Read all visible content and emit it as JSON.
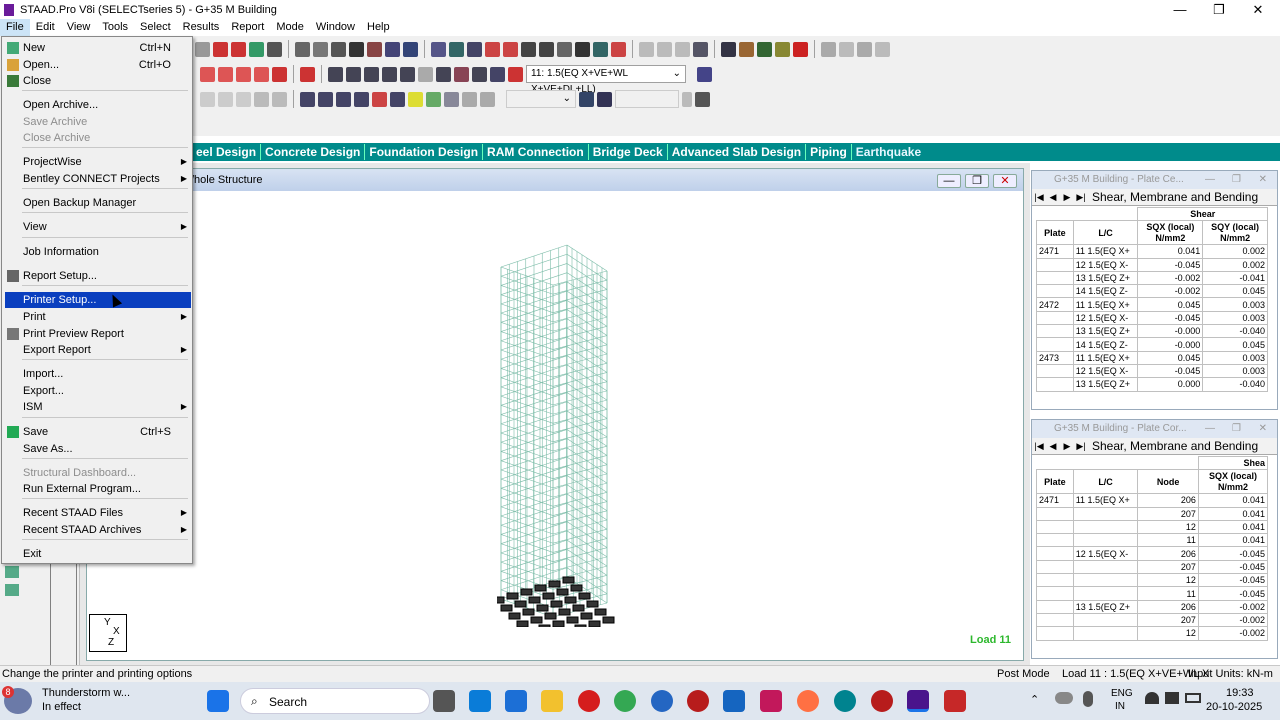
{
  "window": {
    "title": "STAAD.Pro V8i (SELECTseries 5) - G+35 M Building",
    "controls": [
      "—",
      "❐",
      "✕"
    ]
  },
  "menubar": [
    "File",
    "Edit",
    "View",
    "Tools",
    "Select",
    "Results",
    "Report",
    "Mode",
    "Window",
    "Help"
  ],
  "toolbar": {
    "load_case_combo": "11: 1.5(EQ X+VE+WL X+VE+DL+LL)"
  },
  "ribbon_tabs": [
    "eel Design",
    "Concrete Design",
    "Foundation Design",
    "RAM Connection",
    "Bridge Deck",
    "Advanced Slab Design",
    "Piping",
    "Earthquake"
  ],
  "viewport": {
    "title": "/hole Structure",
    "load_label": "Load 11",
    "axis": {
      "y": "Y",
      "x": "X",
      "z": "Z"
    }
  },
  "panel1": {
    "title": "G+35 M Building - Plate Ce...",
    "tab": "Shear, Membrane and Bending",
    "group": "Shear",
    "headers": [
      "Plate",
      "L/C",
      "SQX (local)\nN/mm2",
      "SQY (local)\nN/mm2"
    ],
    "rows": [
      [
        "2471",
        "11 1.5(EQ X+",
        "0.041",
        "0.002"
      ],
      [
        "",
        "12 1.5(EQ X-",
        "-0.045",
        "0.002"
      ],
      [
        "",
        "13 1.5(EQ Z+",
        "-0.002",
        "-0.041"
      ],
      [
        "",
        "14 1.5(EQ Z-",
        "-0.002",
        "0.045"
      ],
      [
        "2472",
        "11 1.5(EQ X+",
        "0.045",
        "0.003"
      ],
      [
        "",
        "12 1.5(EQ X-",
        "-0.045",
        "0.003"
      ],
      [
        "",
        "13 1.5(EQ Z+",
        "-0.000",
        "-0.040"
      ],
      [
        "",
        "14 1.5(EQ Z-",
        "-0.000",
        "0.045"
      ],
      [
        "2473",
        "11 1.5(EQ X+",
        "0.045",
        "0.003"
      ],
      [
        "",
        "12 1.5(EQ X-",
        "-0.045",
        "0.003"
      ],
      [
        "",
        "13 1.5(EQ Z+",
        "0.000",
        "-0.040"
      ]
    ]
  },
  "panel2": {
    "title": "G+35 M Building - Plate Cor...",
    "tab": "Shear, Membrane and Bending",
    "group": "Shea",
    "headers": [
      "Plate",
      "L/C",
      "Node",
      "SQX (local)\nN/mm2"
    ],
    "rows": [
      [
        "2471",
        "11 1.5(EQ X+",
        "206",
        "0.041"
      ],
      [
        "",
        "",
        "207",
        "0.041"
      ],
      [
        "",
        "",
        "12",
        "0.041"
      ],
      [
        "",
        "",
        "11",
        "0.041"
      ],
      [
        "",
        "12 1.5(EQ X-",
        "206",
        "-0.045"
      ],
      [
        "",
        "",
        "207",
        "-0.045"
      ],
      [
        "",
        "",
        "12",
        "-0.045"
      ],
      [
        "",
        "",
        "11",
        "-0.045"
      ],
      [
        "",
        "13 1.5(EQ Z+",
        "206",
        "-0.002"
      ],
      [
        "",
        "",
        "207",
        "-0.002"
      ],
      [
        "",
        "",
        "12",
        "-0.002"
      ]
    ]
  },
  "file_menu": [
    {
      "label": "New",
      "shortcut": "Ctrl+N"
    },
    {
      "label": "Open...",
      "shortcut": "Ctrl+O"
    },
    {
      "label": "Close"
    },
    {
      "label": "Open Archive..."
    },
    {
      "label": "Save Archive",
      "disabled": true
    },
    {
      "label": "Close Archive",
      "disabled": true
    },
    {
      "label": "ProjectWise",
      "submenu": true
    },
    {
      "label": "Bentley CONNECT Projects",
      "submenu": true
    },
    {
      "label": "Open Backup Manager"
    },
    {
      "label": "View",
      "submenu": true
    },
    {
      "label": "Job Information"
    },
    {
      "label": "Report Setup..."
    },
    {
      "label": "Printer Setup...",
      "highlighted": true
    },
    {
      "label": "Print",
      "submenu": true
    },
    {
      "label": "Print Preview Report"
    },
    {
      "label": "Export Report",
      "submenu": true
    },
    {
      "label": "Import..."
    },
    {
      "label": "Export..."
    },
    {
      "label": "ISM",
      "submenu": true
    },
    {
      "label": "Save",
      "shortcut": "Ctrl+S"
    },
    {
      "label": "Save As..."
    },
    {
      "label": "Structural Dashboard...",
      "disabled": true
    },
    {
      "label": "Run External Program..."
    },
    {
      "label": "Recent STAAD Files",
      "submenu": true
    },
    {
      "label": "Recent STAAD Archives",
      "submenu": true
    },
    {
      "label": "Exit"
    }
  ],
  "statusbar": {
    "hint": "Change the printer and printing options",
    "mode": "Post Mode",
    "load": "Load 11 : 1.5(EQ X+VE+WL X",
    "units": "Input Units:  kN-m"
  },
  "taskbar": {
    "weather_title": "Thunderstorm w...",
    "weather_sub": "In effect",
    "weather_badge": "8",
    "search": "Search",
    "lang": "ENG",
    "region": "IN",
    "time": "19:33",
    "date": "20-10-2025"
  },
  "colors": {
    "ribbon": "#008b8b",
    "menu_highlight": "#0a3fbf",
    "load_label": "#2db82d"
  }
}
